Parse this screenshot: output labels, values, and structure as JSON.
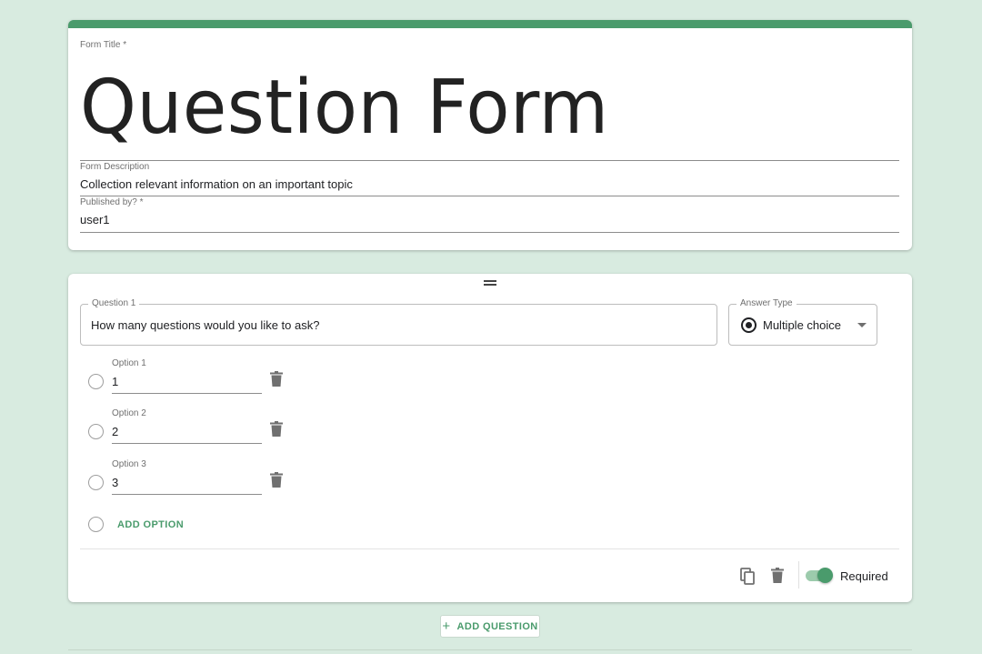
{
  "form": {
    "title_label": "Form Title *",
    "title": "Question Form",
    "description_label": "Form Description",
    "description": "Collection relevant information on an important topic",
    "published_by_label": "Published by? *",
    "published_by": "user1"
  },
  "question": {
    "label": "Question 1",
    "text": "How many questions would you like to ask?",
    "answer_type_label": "Answer Type",
    "answer_type": "Multiple choice",
    "options": [
      {
        "label": "Option 1",
        "value": "1"
      },
      {
        "label": "Option 2",
        "value": "2"
      },
      {
        "label": "Option 3",
        "value": "3"
      }
    ],
    "add_option": "ADD OPTION",
    "required_label": "Required",
    "required": true
  },
  "add_question": "ADD QUESTION",
  "colors": {
    "accent": "#4a9b6c",
    "background": "#d8ebe0"
  },
  "icons": [
    "drag-handle-icon",
    "radio-icon",
    "chevron-down-icon",
    "trash-icon",
    "copy-icon",
    "plus-icon"
  ]
}
